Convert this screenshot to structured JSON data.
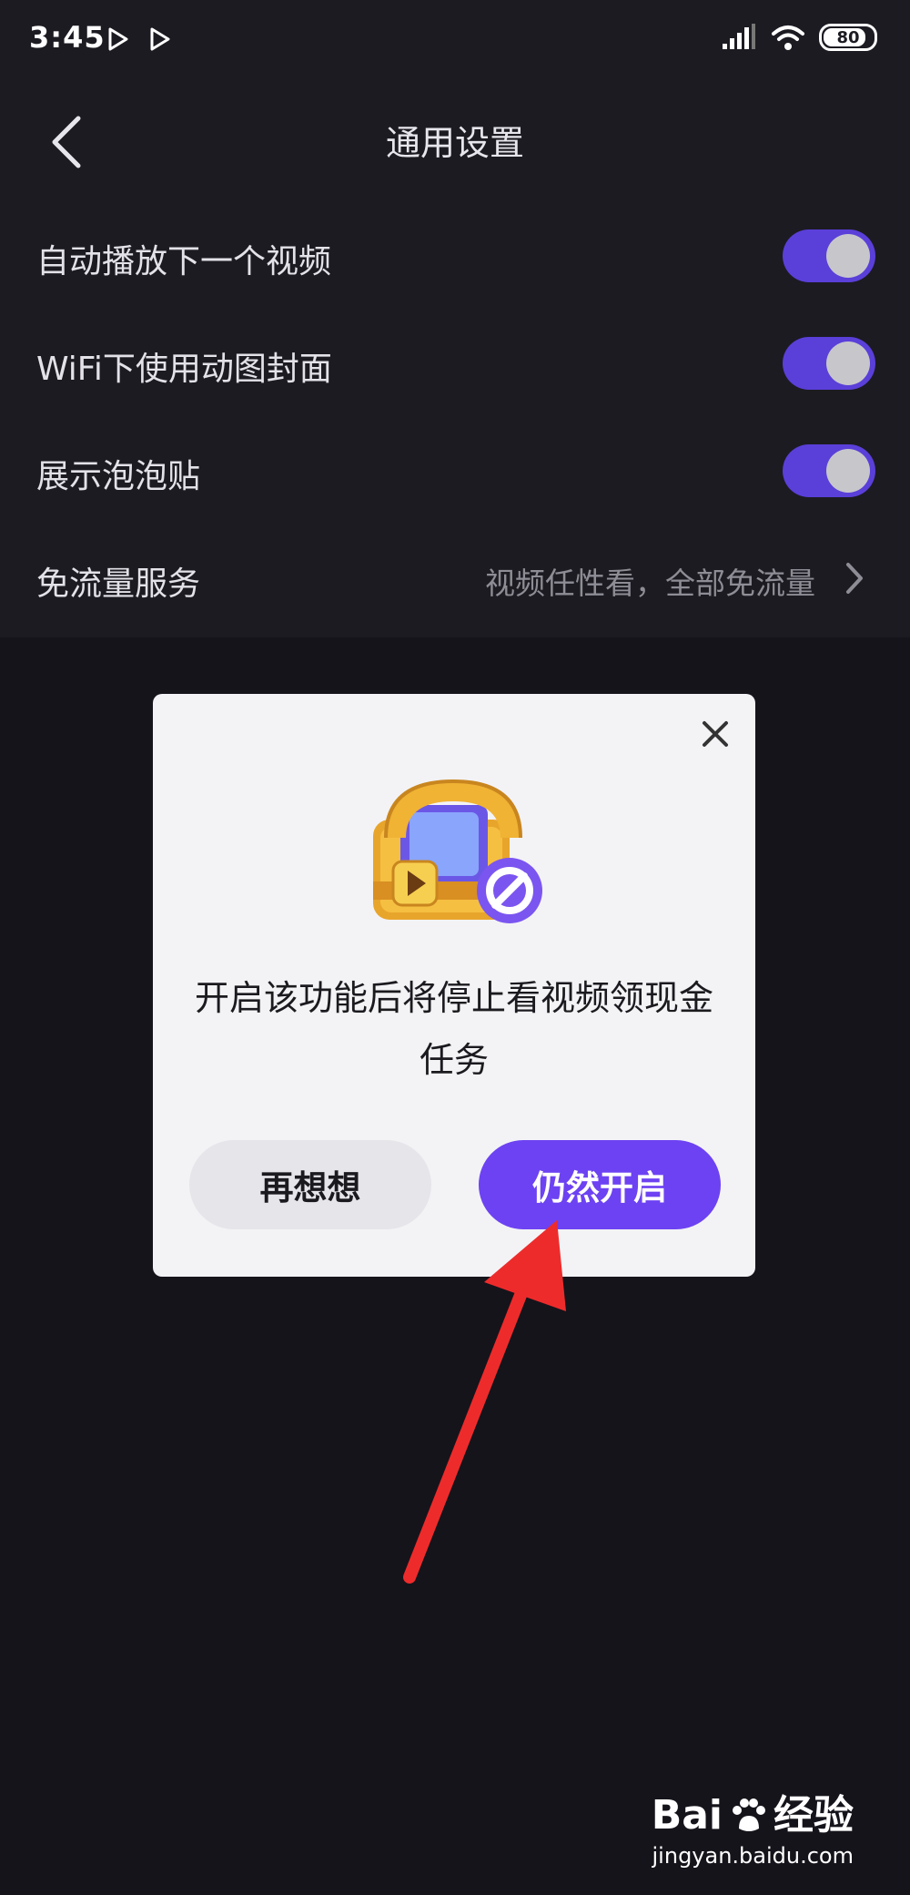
{
  "status_bar": {
    "time": "3:45",
    "battery": "80",
    "icons": [
      "play-icon",
      "play-icon",
      "signal-icon",
      "wifi-icon",
      "battery-icon"
    ]
  },
  "header": {
    "title": "通用设置",
    "back_icon": "chevron-left-icon"
  },
  "settings": {
    "items": [
      {
        "label": "自动播放下一个视频",
        "type": "toggle",
        "enabled": true
      },
      {
        "label": "WiFi下使用动图封面",
        "type": "toggle",
        "enabled": true
      },
      {
        "label": "展示泡泡贴",
        "type": "toggle",
        "enabled": true
      },
      {
        "label": "免流量服务",
        "type": "link",
        "value": "视频任性看，全部免流量",
        "icon": "chevron-right-icon"
      }
    ]
  },
  "dialog": {
    "close_icon": "close-icon",
    "illustration": "treasure-chest-icon",
    "message": "开启该功能后将停止看视频领现金任务",
    "cancel_label": "再想想",
    "confirm_label": "仍然开启"
  },
  "annotation": {
    "arrow_color": "#ee2b2b",
    "arrow_icon": "red-arrow-icon"
  },
  "watermark": {
    "brand_left": "Bai",
    "brand_right": "经验",
    "url": "jingyan.baidu.com"
  },
  "colors": {
    "accent": "#6d42f2",
    "toggle_on": "#5b3fd9",
    "background": "#15141b"
  }
}
